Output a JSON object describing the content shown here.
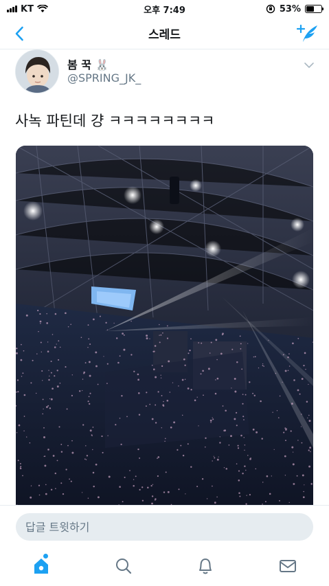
{
  "status_bar": {
    "carrier": "KT",
    "time": "오후 7:49",
    "battery_percent": "53%",
    "battery_level": 0.53
  },
  "nav": {
    "title": "스레드",
    "back_icon": "chevron-left-icon",
    "compose_icon": "compose-tweet-icon"
  },
  "tweet": {
    "display_name": "봄 꾹 🐰",
    "handle": "@SPRING_JK_",
    "text": "사녹 파틴데 걍 ㅋㅋㅋㅋㅋㅋㅋㅋ",
    "media_alt_icon": "concert-photo",
    "menu_icon": "chevron-down-icon"
  },
  "reply": {
    "placeholder": "답글 트윗하기"
  },
  "tab_bar": {
    "items": [
      "home-icon",
      "search-icon",
      "notifications-icon",
      "messages-icon"
    ]
  },
  "colors": {
    "accent": "#1da1f2",
    "secondary_text": "#657786",
    "divider": "#e6ecf0"
  }
}
